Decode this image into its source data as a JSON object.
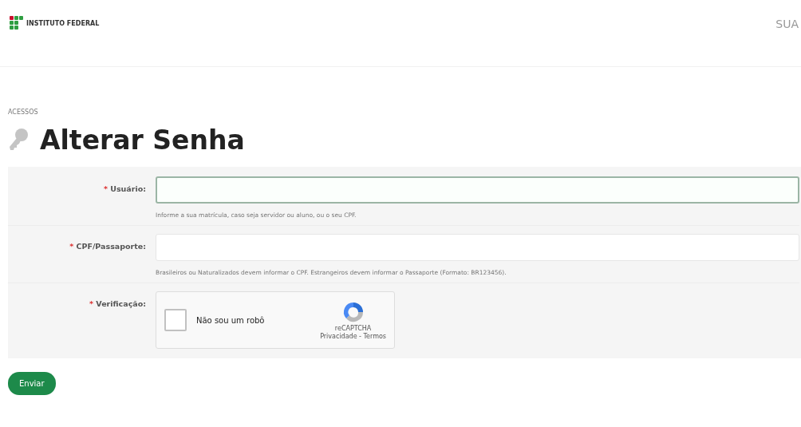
{
  "header": {
    "logo_text": "INSTITUTO FEDERAL",
    "menu_text": "SUA"
  },
  "breadcrumb": "ACESSOS",
  "title": "Alterar Senha",
  "fields": [
    {
      "kind": "text",
      "mark": "*",
      "label": "Usuário:",
      "focused": true,
      "help": "Informe a sua matrícula, caso seja servidor ou aluno, ou o seu CPF."
    },
    {
      "kind": "text",
      "mark": "*",
      "label": "CPF/Passaporte:",
      "focused": false,
      "help": "Brasileiros ou Naturalizados devem informar o CPF. Estrangeiros devem informar o Passaporte (Formato: BR123456)."
    },
    {
      "kind": "recaptcha",
      "mark": "*",
      "label": "Verificação:",
      "checked": false,
      "checkbox_label": "Não sou um robô",
      "brand": "reCAPTCHA",
      "links": "Privacidade - Termos"
    }
  ],
  "submit": "Enviar"
}
